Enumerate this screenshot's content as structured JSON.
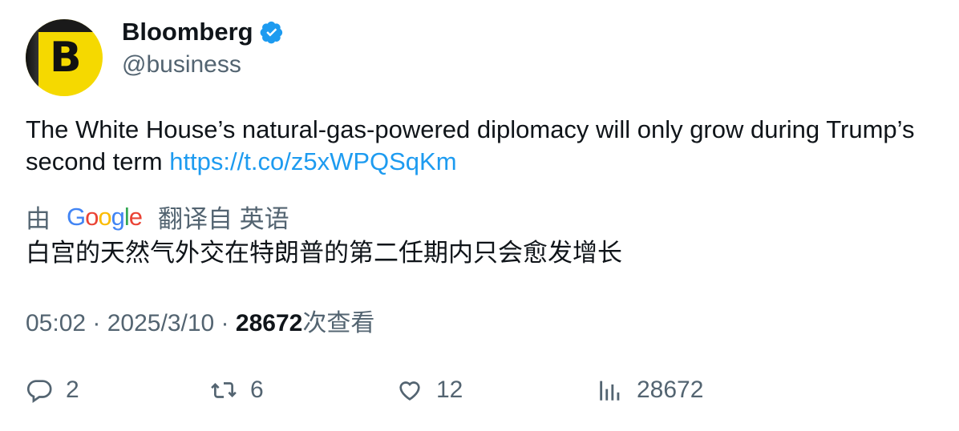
{
  "account": {
    "name": "Bloomberg",
    "handle": "@business",
    "avatar_letter": "B",
    "verified": true
  },
  "tweet": {
    "text": "The White House’s natural-gas-powered diplomacy will only grow during Trump’s second term ",
    "link": "https://t.co/z5xWPQSqKm"
  },
  "translation": {
    "prefix": "由",
    "provider": "Google",
    "suffix": "翻译自 英语",
    "text": "白宫的天然气外交在特朗普的第二任期内只会愈发增长"
  },
  "meta": {
    "time": "05:02",
    "date": "2025/3/10",
    "views_count": "28672",
    "views_label": "次查看"
  },
  "actions": {
    "replies": "2",
    "retweets": "6",
    "likes": "12",
    "views": "28672"
  },
  "colors": {
    "link": "#1d9bf0",
    "secondary_text": "#536471",
    "verified": "#1d9bf0",
    "avatar_bg": "#f5d900"
  }
}
